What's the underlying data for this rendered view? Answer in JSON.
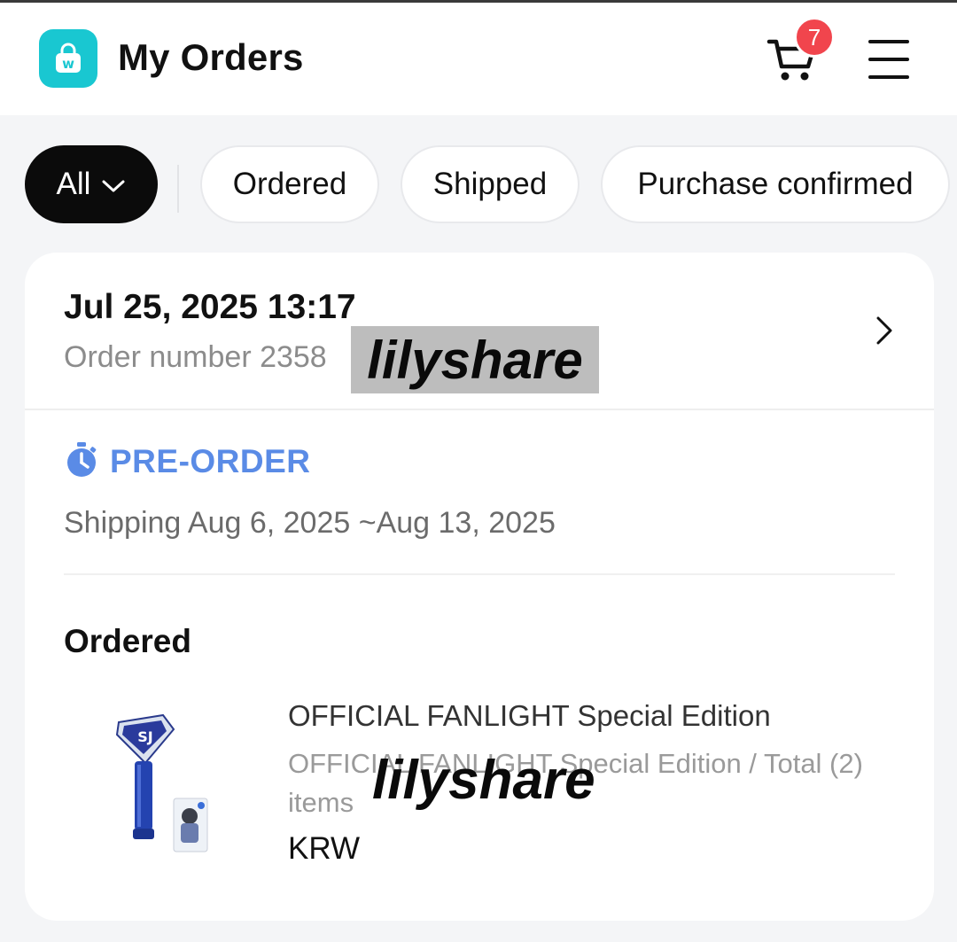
{
  "header": {
    "title": "My Orders",
    "logo_icon": "shopping-bag-w-icon",
    "cart_count": "7",
    "brand_color": "#19c7d1",
    "badge_color": "#f1454d"
  },
  "filters": {
    "all_label": "All",
    "chips": [
      "Ordered",
      "Shipped",
      "Purchase confirmed"
    ]
  },
  "order": {
    "date": "Jul 25, 2025 13:17",
    "number_label": "Order number 2358",
    "watermark": "lilyshare",
    "preorder_label": "PRE-ORDER",
    "preorder_color": "#5a8be6",
    "shipping": "Shipping Aug 6, 2025 ~Aug 13, 2025",
    "status": "Ordered",
    "product": {
      "title": "OFFICIAL FANLIGHT Special Edition",
      "subtitle": "OFFICIAL FANLIGHT Special Edition / Total (2) items",
      "watermark": "lilyshare",
      "price": "KRW"
    }
  }
}
